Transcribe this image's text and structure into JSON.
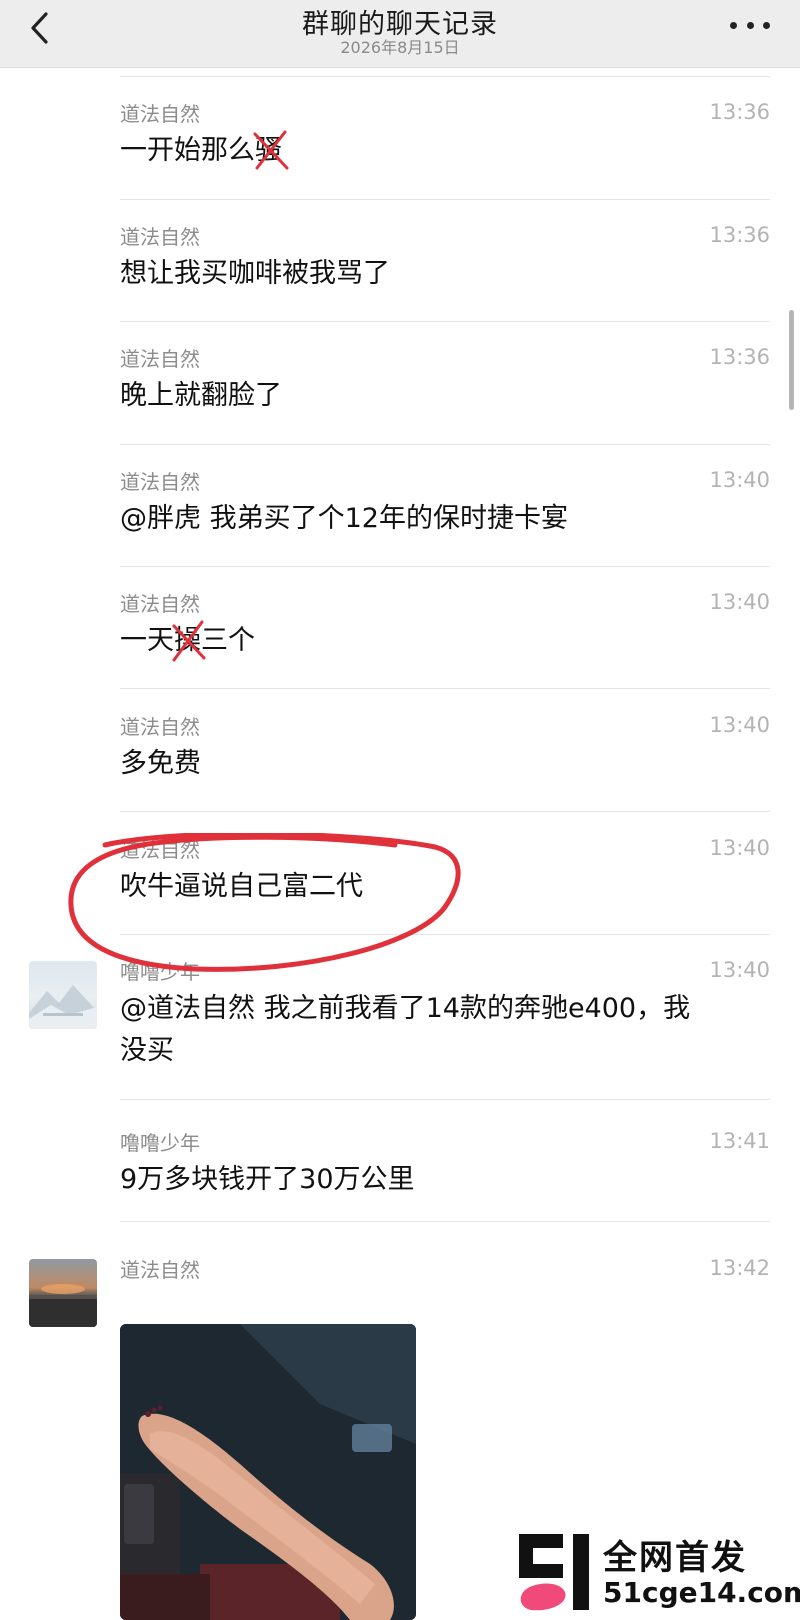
{
  "header": {
    "title": "群聊的聊天记录",
    "subtitle": "2026年8月15日"
  },
  "messages": [
    {
      "sender": "",
      "time": "",
      "text": ""
    },
    {
      "sender": "道法自然",
      "time": "13:36",
      "text_before": "一开始那么",
      "text_struck": "骚",
      "text_after": ""
    },
    {
      "sender": "道法自然",
      "time": "13:36",
      "text": "想让我买咖啡被我骂了"
    },
    {
      "sender": "道法自然",
      "time": "13:36",
      "text": "晚上就翻脸了"
    },
    {
      "sender": "道法自然",
      "time": "13:40",
      "text": "@胖虎 我弟买了个12年的保时捷卡宴"
    },
    {
      "sender": "道法自然",
      "time": "13:40",
      "text_before": "一天",
      "text_struck": "操",
      "text_after": "三个"
    },
    {
      "sender": "道法自然",
      "time": "13:40",
      "text": "多免费"
    },
    {
      "sender": "道法自然",
      "time": "13:40",
      "text": "吹牛逼说自己富二代"
    },
    {
      "sender": "噜噜少年",
      "time": "13:40",
      "text_line1": "@道法自然 我之前我看了14款的奔驰e400，我",
      "text_line2": "没买"
    },
    {
      "sender": "噜噜少年",
      "time": "13:41",
      "text": "9万多块钱开了30万公里"
    },
    {
      "sender": "道法自然",
      "time": "13:42"
    }
  ],
  "watermark": {
    "line1": "全网首发",
    "line2": "51cge14.com",
    "logo_text": "51"
  },
  "colors": {
    "header_bg": "#ededed",
    "annotation_red": "#e0303a",
    "watermark_pink": "#f04a7a"
  },
  "icons": {
    "back": "chevron-left-icon",
    "more": "more-dots-icon"
  }
}
